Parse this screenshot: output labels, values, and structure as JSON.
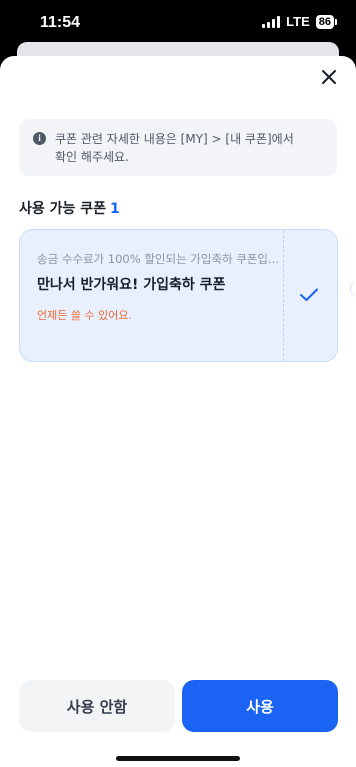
{
  "status_bar": {
    "time": "11:54",
    "network": "LTE",
    "battery": "86"
  },
  "info": {
    "line1": "쿠폰 관련 자세한 내용은 [MY] > [내 쿠폰]에서",
    "line2": "확인 해주세요."
  },
  "section": {
    "title": "사용 가능 쿠폰",
    "count": "1"
  },
  "coupon": {
    "description": "송금 수수료가 100% 할인되는 가입축하 쿠폰입...",
    "name": "만나서 반가워요! 가입축하 쿠폰",
    "validity": "언제든 쓸 수 있어요.",
    "selected": true
  },
  "buttons": {
    "cancel": "사용 안함",
    "use": "사용"
  },
  "colors": {
    "accent": "#1b64f3",
    "coupon_bg": "#e8f0fd",
    "note": "#f06a3a"
  }
}
